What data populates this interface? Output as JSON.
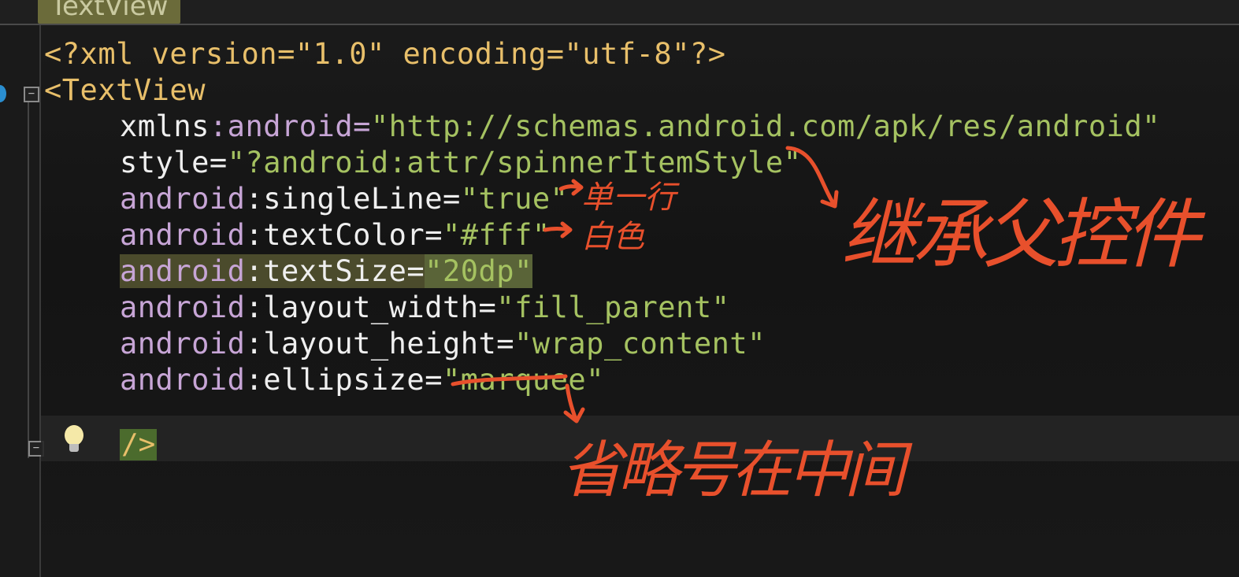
{
  "tab": {
    "title": "TextView"
  },
  "code": {
    "xml_decl": "<?xml version=\"1.0\" encoding=\"utf-8\"?>",
    "tag_open": "<TextView",
    "lines": [
      {
        "ns": "xmlns",
        "name": ":android=",
        "value": "\"http://schemas.android.com/apk/res/android\""
      },
      {
        "ns": "",
        "name": "style=",
        "value": "\"?android:attr/spinnerItemStyle\""
      },
      {
        "ns": "android",
        "name": ":singleLine=",
        "value": "\"true\""
      },
      {
        "ns": "android",
        "name": ":textColor=",
        "value": "\"#fff\""
      },
      {
        "ns": "android",
        "name": ":textSize=",
        "value": "\"20dp\""
      },
      {
        "ns": "android",
        "name": ":layout_width=",
        "value": "\"fill_parent\""
      },
      {
        "ns": "android",
        "name": ":layout_height=",
        "value": "\"wrap_content\""
      },
      {
        "ns": "android",
        "name": ":ellipsize=",
        "value": "\"marquee\""
      }
    ],
    "tag_close": "/>"
  },
  "annotations": {
    "single_line": "单一行",
    "white": "白色",
    "inherit_parent": "继承父控件",
    "ellipsis_middle": "省略号在中间"
  },
  "icons": {
    "intention": "lightbulb-icon",
    "fold_open": "fold-minus-icon",
    "fold_close": "fold-minus-icon",
    "breakpoint": "breakpoint-icon"
  },
  "colors": {
    "background": "#151515",
    "string": "#a5c261",
    "tag": "#e8bf6a",
    "namespace": "#c7a5d6",
    "annotation": "#e8502c"
  }
}
